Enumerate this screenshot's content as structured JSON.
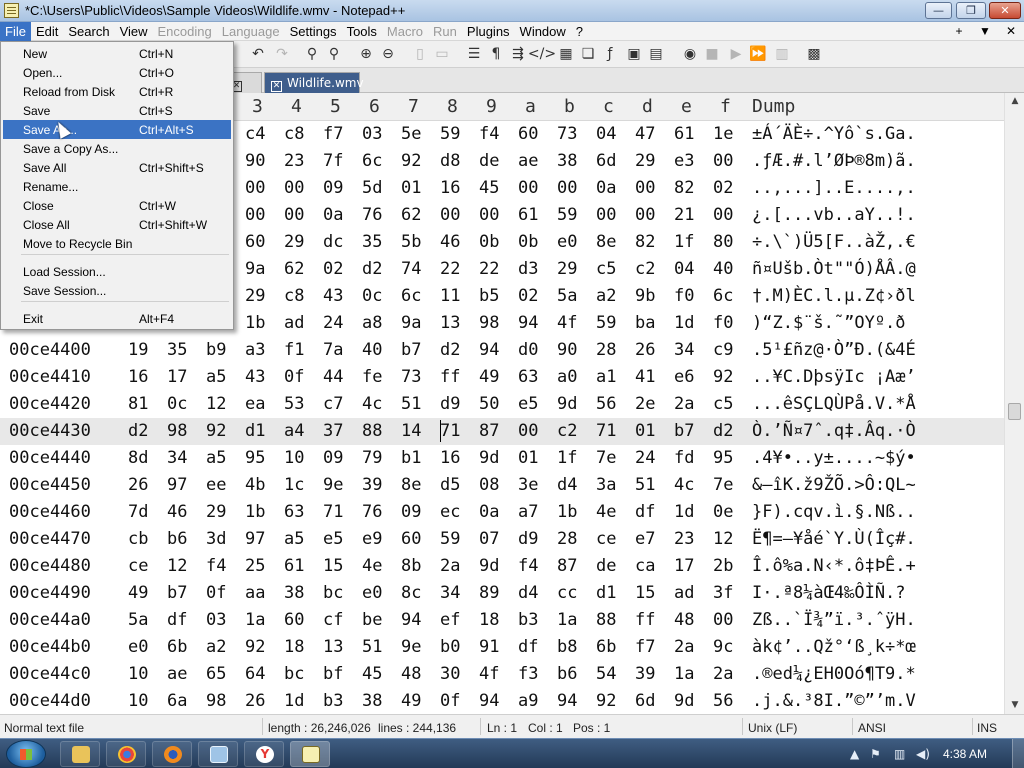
{
  "window": {
    "title": "*C:\\Users\\Public\\Videos\\Sample Videos\\Wildlife.wmv - Notepad++",
    "minimize_glyph": "—",
    "maximize_glyph": "❐",
    "close_glyph": "✕"
  },
  "menubar": {
    "items": [
      "File",
      "Edit",
      "Search",
      "View",
      "Encoding",
      "Language",
      "Settings",
      "Tools",
      "Macro",
      "Run",
      "Plugins",
      "Window",
      "?"
    ],
    "active": "File",
    "disabled": [
      "Encoding",
      "Language",
      "Macro",
      "Run"
    ],
    "right_icons": [
      "+",
      "▼",
      "✕"
    ]
  },
  "tabs": [
    {
      "label": "",
      "close": "✕",
      "state": "inactive"
    },
    {
      "label": "Wildlife.wmv",
      "close": "✕",
      "state": "active"
    }
  ],
  "hex_header": {
    "columns": [
      "3",
      "4",
      "5",
      "6",
      "7",
      "8",
      "9",
      "a",
      "b",
      "c",
      "d",
      "e",
      "f"
    ],
    "dump_label": "Dump"
  },
  "hex_rows": [
    {
      "addr": "",
      "bytes": [
        "c4",
        "c8",
        "f7",
        "03",
        "5e",
        "59",
        "f4",
        "60",
        "73",
        "04",
        "47",
        "61",
        "1e"
      ],
      "dump": "±Á´ÄÈ÷.^Yô`s.Ga."
    },
    {
      "addr": "",
      "bytes": [
        "90",
        "23",
        "7f",
        "6c",
        "92",
        "d8",
        "de",
        "ae",
        "38",
        "6d",
        "29",
        "e3",
        "00"
      ],
      "dump": ".ƒÆ.#.l’ØÞ®8m)ã."
    },
    {
      "addr": "",
      "bytes": [
        "00",
        "00",
        "09",
        "5d",
        "01",
        "16",
        "45",
        "00",
        "00",
        "0a",
        "00",
        "82",
        "02"
      ],
      "dump": "..,...]..E....,."
    },
    {
      "addr": "",
      "bytes": [
        "00",
        "00",
        "0a",
        "76",
        "62",
        "00",
        "00",
        "61",
        "59",
        "00",
        "00",
        "21",
        "00"
      ],
      "dump": "¿.[...vb..aY..!."
    },
    {
      "addr": "",
      "bytes": [
        "60",
        "29",
        "dc",
        "35",
        "5b",
        "46",
        "0b",
        "0b",
        "e0",
        "8e",
        "82",
        "1f",
        "80"
      ],
      "dump": "÷.\\`)Ü5[F..àŽ,.€"
    },
    {
      "addr": "",
      "bytes": [
        "9a",
        "62",
        "02",
        "d2",
        "74",
        "22",
        "22",
        "d3",
        "29",
        "c5",
        "c2",
        "04",
        "40"
      ],
      "dump": "ñ¤Ušb.Òt\"\"Ó)ÅÂ.@"
    },
    {
      "addr": "",
      "bytes": [
        "29",
        "c8",
        "43",
        "0c",
        "6c",
        "11",
        "b5",
        "02",
        "5a",
        "a2",
        "9b",
        "f0",
        "6c"
      ],
      "dump": "†.M)ÈC.l.µ.Z¢›ðl"
    },
    {
      "addr": "",
      "bytes": [
        "1b",
        "ad",
        "24",
        "a8",
        "9a",
        "13",
        "98",
        "94",
        "4f",
        "59",
        "ba",
        "1d",
        "f0"
      ],
      "dump": ")“Z.­$¨š.˜”OYº.ð"
    },
    {
      "addr": "00ce4400",
      "bytes": [
        "19",
        "35",
        "b9",
        "a3",
        "f1",
        "7a",
        "40",
        "b7",
        "d2",
        "94",
        "d0",
        "90",
        "28",
        "26",
        "34",
        "c9"
      ],
      "dump": ".5¹£ñz@·Ò”Ð.(&4É"
    },
    {
      "addr": "00ce4410",
      "bytes": [
        "16",
        "17",
        "a5",
        "43",
        "0f",
        "44",
        "fe",
        "73",
        "ff",
        "49",
        "63",
        "a0",
        "a1",
        "41",
        "e6",
        "92"
      ],
      "dump": "..¥C.DþsÿIc ¡Aæ’"
    },
    {
      "addr": "00ce4420",
      "bytes": [
        "81",
        "0c",
        "12",
        "ea",
        "53",
        "c7",
        "4c",
        "51",
        "d9",
        "50",
        "e5",
        "9d",
        "56",
        "2e",
        "2a",
        "c5"
      ],
      "dump": "...êSÇLQÙPå.V.*Å"
    },
    {
      "addr": "00ce4430",
      "bytes": [
        "d2",
        "98",
        "92",
        "d1",
        "a4",
        "37",
        "88",
        "14",
        "71",
        "87",
        "00",
        "c2",
        "71",
        "01",
        "b7",
        "d2"
      ],
      "dump": "Ò.’Ñ¤7ˆ.q‡.Âq.·Ò"
    },
    {
      "addr": "00ce4440",
      "bytes": [
        "8d",
        "34",
        "a5",
        "95",
        "10",
        "09",
        "79",
        "b1",
        "16",
        "9d",
        "01",
        "1f",
        "7e",
        "24",
        "fd",
        "95"
      ],
      "dump": ".4¥•..y±....~$ý•"
    },
    {
      "addr": "00ce4450",
      "bytes": [
        "26",
        "97",
        "ee",
        "4b",
        "1c",
        "9e",
        "39",
        "8e",
        "d5",
        "08",
        "3e",
        "d4",
        "3a",
        "51",
        "4c",
        "7e"
      ],
      "dump": "&—îK.ž9ŽÕ.>Ô:QL~"
    },
    {
      "addr": "00ce4460",
      "bytes": [
        "7d",
        "46",
        "29",
        "1b",
        "63",
        "71",
        "76",
        "09",
        "ec",
        "0a",
        "a7",
        "1b",
        "4e",
        "df",
        "1d",
        "0e"
      ],
      "dump": "}F).cqv.ì.§.Nß.."
    },
    {
      "addr": "00ce4470",
      "bytes": [
        "cb",
        "b6",
        "3d",
        "97",
        "a5",
        "e5",
        "e9",
        "60",
        "59",
        "07",
        "d9",
        "28",
        "ce",
        "e7",
        "23",
        "12"
      ],
      "dump": "Ë¶=—¥åé`Y.Ù(Îç#."
    },
    {
      "addr": "00ce4480",
      "bytes": [
        "ce",
        "12",
        "f4",
        "25",
        "61",
        "15",
        "4e",
        "8b",
        "2a",
        "9d",
        "f4",
        "87",
        "de",
        "ca",
        "17",
        "2b"
      ],
      "dump": "Î.ô%a.N‹*.ô‡ÞÊ.+"
    },
    {
      "addr": "00ce4490",
      "bytes": [
        "49",
        "b7",
        "0f",
        "aa",
        "38",
        "bc",
        "e0",
        "8c",
        "34",
        "89",
        "d4",
        "cc",
        "d1",
        "15",
        "ad",
        "3f"
      ],
      "dump": "I·.ª8¼àŒ4‰ÔÌÑ.­?"
    },
    {
      "addr": "00ce44a0",
      "bytes": [
        "5a",
        "df",
        "03",
        "1a",
        "60",
        "cf",
        "be",
        "94",
        "ef",
        "18",
        "b3",
        "1a",
        "88",
        "ff",
        "48",
        "00"
      ],
      "dump": "Zß..`Ï¾”ï.³.ˆÿH."
    },
    {
      "addr": "00ce44b0",
      "bytes": [
        "e0",
        "6b",
        "a2",
        "92",
        "18",
        "13",
        "51",
        "9e",
        "b0",
        "91",
        "df",
        "b8",
        "6b",
        "f7",
        "2a",
        "9c"
      ],
      "dump": "àk¢’..Qž°‘ß¸k÷*œ"
    },
    {
      "addr": "00ce44c0",
      "bytes": [
        "10",
        "ae",
        "65",
        "64",
        "bc",
        "bf",
        "45",
        "48",
        "30",
        "4f",
        "f3",
        "b6",
        "54",
        "39",
        "1a",
        "2a"
      ],
      "dump": ".®ed¼¿EH0Oó¶T9.*"
    },
    {
      "addr": "00ce44d0",
      "bytes": [
        "10",
        "6a",
        "98",
        "26",
        "1d",
        "b3",
        "38",
        "49",
        "0f",
        "94",
        "a9",
        "94",
        "92",
        "6d",
        "9d",
        "56"
      ],
      "dump": ".j.&.³8I.”©”’m.V"
    }
  ],
  "file_menu": {
    "items": [
      {
        "label": "New",
        "shortcut": "Ctrl+N"
      },
      {
        "label": "Open...",
        "shortcut": "Ctrl+O"
      },
      {
        "label": "Reload from Disk",
        "shortcut": "Ctrl+R"
      },
      {
        "label": "Save",
        "shortcut": "Ctrl+S"
      },
      {
        "label": "Save As...",
        "shortcut": "Ctrl+Alt+S",
        "selected": true
      },
      {
        "label": "Save a Copy As...",
        "shortcut": ""
      },
      {
        "label": "Save All",
        "shortcut": "Ctrl+Shift+S"
      },
      {
        "label": "Rename...",
        "shortcut": ""
      },
      {
        "label": "Close",
        "shortcut": "Ctrl+W"
      },
      {
        "label": "Close All",
        "shortcut": "Ctrl+Shift+W"
      },
      {
        "label": "Move to Recycle Bin",
        "shortcut": ""
      },
      {
        "label": "Load Session...",
        "shortcut": ""
      },
      {
        "label": "Save Session...",
        "shortcut": ""
      },
      {
        "label": "Exit",
        "shortcut": "Alt+F4"
      }
    ]
  },
  "statusbar": {
    "file_type": "Normal text file",
    "length": "length : 26,246,026",
    "lines": "lines : 244,136",
    "ln": "Ln : 1",
    "col": "Col : 1",
    "pos": "Pos : 1",
    "eol": "Unix (LF)",
    "encoding": "ANSI",
    "ins": "INS"
  },
  "taskbar": {
    "clock": "4:38 AM",
    "apps": [
      "explorer",
      "chrome",
      "firefox",
      "remote-desktop",
      "yandex",
      "notepad++"
    ]
  },
  "colors": {
    "menu_highlight": "#3b73c4",
    "active_tab": "#3f5e8c",
    "taskbar": "#233a57"
  }
}
